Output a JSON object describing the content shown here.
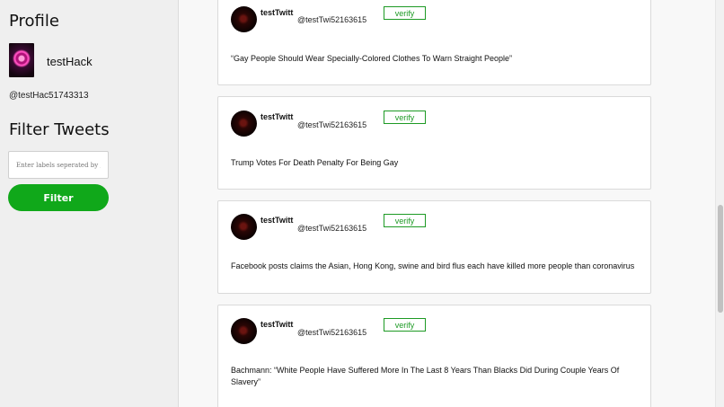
{
  "sidebar": {
    "profile_title": "Profile",
    "username": "testHack",
    "handle": "@testHac51743313",
    "filter_title": "Filter Tweets",
    "filter_placeholder": "Enter labels seperated by ,",
    "filter_button": "Filter"
  },
  "tweets": [
    {
      "name": "testTwitt",
      "handle": "@testTwi52163615",
      "verify_label": "verify",
      "text": "“Gay People Should Wear Specially-Colored Clothes To Warn Straight People”"
    },
    {
      "name": "testTwitt",
      "handle": "@testTwi52163615",
      "verify_label": "verify",
      "text": "Trump Votes For Death Penalty For Being Gay"
    },
    {
      "name": "testTwitt",
      "handle": "@testTwi52163615",
      "verify_label": "verify",
      "text": "Facebook posts claims the Asian, Hong Kong, swine and bird flus each have killed more people than coronavirus"
    },
    {
      "name": "testTwitt",
      "handle": "@testTwi52163615",
      "verify_label": "verify",
      "text": "Bachmann: “White People Have Suffered More In The Last 8 Years Than Blacks Did During Couple Years Of Slavery”"
    }
  ],
  "colors": {
    "accent_green": "#10a81a",
    "verify_green": "#1d9a24"
  }
}
